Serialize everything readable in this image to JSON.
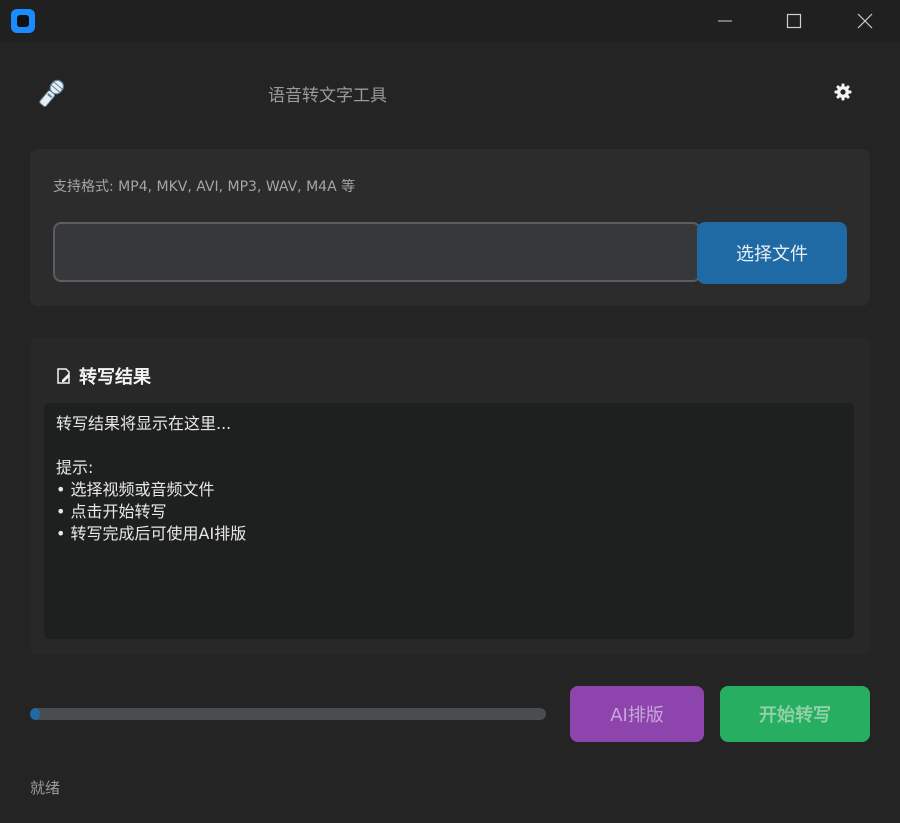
{
  "window": {
    "controls": {
      "minimize_icon": "minimize-icon",
      "maximize_icon": "maximize-icon",
      "close_icon": "close-icon"
    }
  },
  "header": {
    "title": "语音转文字工具",
    "logo_icon": "microphone-icon",
    "settings_icon": "gear-icon"
  },
  "file_panel": {
    "formats_label": "支持格式: MP4, MKV, AVI, MP3, WAV, M4A 等",
    "path_value": "",
    "choose_button": "选择文件"
  },
  "result_panel": {
    "title": "转写结果",
    "title_icon": "edit-document-icon",
    "text": "转写结果将显示在这里...\n\n提示:\n• 选择视频或音频文件\n• 点击开始转写\n• 转写完成后可使用AI排版"
  },
  "footer": {
    "progress": 0.02,
    "ai_button": "AI排版",
    "start_button": "开始转写",
    "status": "就绪"
  },
  "colors": {
    "accent": "#1f6aa5",
    "ai_button": "#8e44ad",
    "start_button": "#27ae60",
    "background": "#242424"
  }
}
